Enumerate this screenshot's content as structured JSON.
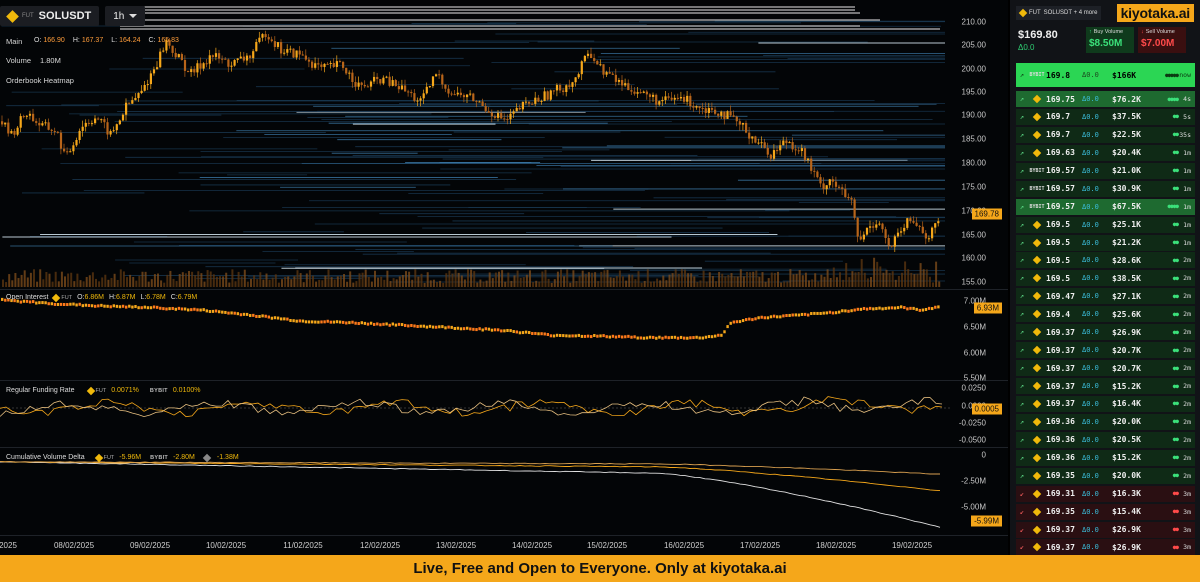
{
  "header": {
    "exchange_tag": "FUT",
    "symbol": "SOLUSDT",
    "timeframe": "1h"
  },
  "main_pane": {
    "title": "Main",
    "ohlc": [
      {
        "k": "O:",
        "v": "166.90"
      },
      {
        "k": "H:",
        "v": "167.37"
      },
      {
        "k": "L:",
        "v": "164.24"
      },
      {
        "k": "C:",
        "v": "165.83"
      }
    ],
    "volume_label": "Volume",
    "volume_value": "1.80M",
    "heatmap_label": "Orderbook Heatmap",
    "y_ticks": [
      "210.00",
      "205.00",
      "200.00",
      "195.00",
      "190.00",
      "185.00",
      "180.00",
      "175.00",
      "170.00",
      "165.00",
      "160.00",
      "155.00"
    ],
    "price_badge": "169.78"
  },
  "oi_pane": {
    "title": "Open Interest",
    "exchange_tag": "FUT",
    "ohlc": [
      {
        "k": "O:",
        "v": "6.86M"
      },
      {
        "k": "H:",
        "v": "6.87M"
      },
      {
        "k": "L:",
        "v": "6.78M"
      },
      {
        "k": "C:",
        "v": "6.79M"
      }
    ],
    "y_ticks": [
      "7.00M",
      "6.50M",
      "6.00M",
      "5.50M"
    ],
    "badge": "6.93M"
  },
  "funding_pane": {
    "title": "Regular Funding Rate",
    "ex1": "FUT",
    "v1": "0.0071%",
    "ex2": "BYBIT",
    "v2": "0.0100%",
    "y_ticks": [
      "0.0250",
      "0.0000",
      "-0.0250",
      "-0.0500"
    ],
    "badge": "0.0005"
  },
  "cvd_pane": {
    "title": "Cumulative Volume Delta",
    "ex1": "FUT",
    "v1": "-5.96M",
    "ex2": "BYBIT",
    "v2": "-2.80M",
    "ex3": "",
    "v3": "-1.38M",
    "y_ticks": [
      "0",
      "-2.50M",
      "-5.00M"
    ],
    "badge": "-5.99M"
  },
  "x_axis": [
    "2025",
    "08/02/2025",
    "09/02/2025",
    "10/02/2025",
    "11/02/2025",
    "12/02/2025",
    "13/02/2025",
    "14/02/2025",
    "15/02/2025",
    "16/02/2025",
    "17/02/2025",
    "18/02/2025",
    "19/02/2025"
  ],
  "chart_data": {
    "type": "candlestick",
    "symbol": "SOLUSDT",
    "timeframe": "1h",
    "price_axis": {
      "ylim": [
        155,
        212
      ]
    },
    "price_path": [
      [
        0,
        189
      ],
      [
        10,
        186
      ],
      [
        25,
        191
      ],
      [
        40,
        188
      ],
      [
        55,
        187
      ],
      [
        65,
        181
      ],
      [
        80,
        188
      ],
      [
        95,
        190
      ],
      [
        110,
        186
      ],
      [
        125,
        192
      ],
      [
        140,
        195
      ],
      [
        155,
        201
      ],
      [
        165,
        206
      ],
      [
        175,
        203
      ],
      [
        190,
        199
      ],
      [
        210,
        203
      ],
      [
        230,
        201
      ],
      [
        250,
        203
      ],
      [
        265,
        208
      ],
      [
        280,
        204
      ],
      [
        300,
        203
      ],
      [
        320,
        200
      ],
      [
        340,
        201
      ],
      [
        360,
        196
      ],
      [
        380,
        198
      ],
      [
        400,
        196
      ],
      [
        420,
        193
      ],
      [
        435,
        199
      ],
      [
        450,
        195
      ],
      [
        470,
        194
      ],
      [
        490,
        191
      ],
      [
        505,
        189
      ],
      [
        520,
        192
      ],
      [
        540,
        194
      ],
      [
        560,
        196
      ],
      [
        575,
        198
      ],
      [
        588,
        204
      ],
      [
        600,
        200
      ],
      [
        620,
        197
      ],
      [
        640,
        195
      ],
      [
        660,
        193
      ],
      [
        680,
        194
      ],
      [
        700,
        192
      ],
      [
        720,
        191
      ],
      [
        740,
        188
      ],
      [
        755,
        185
      ],
      [
        770,
        182
      ],
      [
        785,
        185
      ],
      [
        800,
        183
      ],
      [
        810,
        179
      ],
      [
        820,
        175
      ],
      [
        830,
        177
      ],
      [
        840,
        174
      ],
      [
        850,
        172
      ],
      [
        858,
        163
      ],
      [
        868,
        167
      ],
      [
        878,
        168
      ],
      [
        888,
        162
      ],
      [
        898,
        165
      ],
      [
        908,
        168
      ],
      [
        918,
        167
      ],
      [
        928,
        164
      ],
      [
        940,
        169.8
      ]
    ],
    "open_interest": [
      [
        0,
        7.05
      ],
      [
        50,
        6.98
      ],
      [
        100,
        6.93
      ],
      [
        150,
        6.9
      ],
      [
        200,
        6.85
      ],
      [
        250,
        6.75
      ],
      [
        300,
        6.63
      ],
      [
        350,
        6.6
      ],
      [
        400,
        6.55
      ],
      [
        450,
        6.5
      ],
      [
        500,
        6.45
      ],
      [
        550,
        6.35
      ],
      [
        600,
        6.33
      ],
      [
        650,
        6.3
      ],
      [
        700,
        6.3
      ],
      [
        720,
        6.35
      ],
      [
        730,
        6.6
      ],
      [
        760,
        6.7
      ],
      [
        800,
        6.75
      ],
      [
        830,
        6.8
      ],
      [
        860,
        6.87
      ],
      [
        900,
        6.9
      ],
      [
        920,
        6.85
      ],
      [
        940,
        6.93
      ]
    ],
    "funding_series": [
      {
        "name": "FUT",
        "color": "#f5a71a"
      },
      {
        "name": "BYBIT",
        "color": "#e8c080"
      }
    ],
    "cvd_series": [
      {
        "name": "FUT",
        "value": -5.96,
        "color": "#e0e0e0"
      },
      {
        "name": "BYBIT",
        "value": -2.8,
        "color": "#f5a71a"
      },
      {
        "value": -1.38,
        "color": "#d9a050"
      }
    ]
  },
  "sidebar": {
    "exchange_tag": "FUT",
    "symbols_chip": "SOLUSDT + 4 more",
    "brand": "kiyotaka.ai",
    "price": "$169.80",
    "delta": "Δ0.0",
    "buy_volume_label": "Buy Volume",
    "buy_volume": "$8.50M",
    "sell_volume_label": "Sell Volume",
    "sell_volume": "$7.00M",
    "trades": [
      {
        "side": "buy",
        "style": "top",
        "ex": "BYBIT",
        "price": "169.8",
        "delta": "Δ0.0",
        "size": "$166K",
        "dots": "●●●●●",
        "ago": "now"
      },
      {
        "side": "buy",
        "style": "hi",
        "ex": "FUT",
        "price": "169.75",
        "delta": "Δ0.0",
        "size": "$76.2K",
        "dots": "●●●●",
        "ago": "4s"
      },
      {
        "side": "buy",
        "style": "",
        "ex": "FUT",
        "price": "169.7",
        "delta": "Δ0.0",
        "size": "$37.5K",
        "dots": "●●",
        "ago": "5s"
      },
      {
        "side": "buy",
        "style": "",
        "ex": "FUT",
        "price": "169.7",
        "delta": "Δ0.0",
        "size": "$22.5K",
        "dots": "●●",
        "ago": "35s"
      },
      {
        "side": "buy",
        "style": "",
        "ex": "FUT",
        "price": "169.63",
        "delta": "Δ0.0",
        "size": "$20.4K",
        "dots": "●●",
        "ago": "1m"
      },
      {
        "side": "buy",
        "style": "",
        "ex": "BYBIT",
        "price": "169.57",
        "delta": "Δ0.0",
        "size": "$21.0K",
        "dots": "●●",
        "ago": "1m"
      },
      {
        "side": "buy",
        "style": "",
        "ex": "BYBIT",
        "price": "169.57",
        "delta": "Δ0.0",
        "size": "$30.9K",
        "dots": "●●",
        "ago": "1m"
      },
      {
        "side": "buy",
        "style": "hi",
        "ex": "BYBIT",
        "price": "169.57",
        "delta": "Δ0.0",
        "size": "$67.5K",
        "dots": "●●●●",
        "ago": "1m"
      },
      {
        "side": "buy",
        "style": "",
        "ex": "FUT",
        "price": "169.5",
        "delta": "Δ0.0",
        "size": "$25.1K",
        "dots": "●●",
        "ago": "1m"
      },
      {
        "side": "buy",
        "style": "",
        "ex": "FUT",
        "price": "169.5",
        "delta": "Δ0.0",
        "size": "$21.2K",
        "dots": "●●",
        "ago": "1m"
      },
      {
        "side": "buy",
        "style": "",
        "ex": "FUT",
        "price": "169.5",
        "delta": "Δ0.0",
        "size": "$28.6K",
        "dots": "●●",
        "ago": "2m"
      },
      {
        "side": "buy",
        "style": "",
        "ex": "FUT",
        "price": "169.5",
        "delta": "Δ0.0",
        "size": "$38.5K",
        "dots": "●●",
        "ago": "2m"
      },
      {
        "side": "buy",
        "style": "",
        "ex": "FUT",
        "price": "169.47",
        "delta": "Δ0.0",
        "size": "$27.1K",
        "dots": "●●",
        "ago": "2m"
      },
      {
        "side": "buy",
        "style": "",
        "ex": "FUT",
        "price": "169.4",
        "delta": "Δ0.0",
        "size": "$25.6K",
        "dots": "●●",
        "ago": "2m"
      },
      {
        "side": "buy",
        "style": "",
        "ex": "FUT",
        "price": "169.37",
        "delta": "Δ0.0",
        "size": "$26.9K",
        "dots": "●●",
        "ago": "2m"
      },
      {
        "side": "buy",
        "style": "",
        "ex": "FUT",
        "price": "169.37",
        "delta": "Δ0.0",
        "size": "$20.7K",
        "dots": "●●",
        "ago": "2m"
      },
      {
        "side": "buy",
        "style": "",
        "ex": "FUT",
        "price": "169.37",
        "delta": "Δ0.0",
        "size": "$20.7K",
        "dots": "●●",
        "ago": "2m"
      },
      {
        "side": "buy",
        "style": "",
        "ex": "FUT",
        "price": "169.37",
        "delta": "Δ0.0",
        "size": "$15.2K",
        "dots": "●●",
        "ago": "2m"
      },
      {
        "side": "buy",
        "style": "",
        "ex": "FUT",
        "price": "169.37",
        "delta": "Δ0.0",
        "size": "$16.4K",
        "dots": "●●",
        "ago": "2m"
      },
      {
        "side": "buy",
        "style": "",
        "ex": "FUT",
        "price": "169.36",
        "delta": "Δ0.0",
        "size": "$20.0K",
        "dots": "●●",
        "ago": "2m"
      },
      {
        "side": "buy",
        "style": "",
        "ex": "FUT",
        "price": "169.36",
        "delta": "Δ0.0",
        "size": "$20.5K",
        "dots": "●●",
        "ago": "2m"
      },
      {
        "side": "buy",
        "style": "",
        "ex": "FUT",
        "price": "169.36",
        "delta": "Δ0.0",
        "size": "$15.2K",
        "dots": "●●",
        "ago": "2m"
      },
      {
        "side": "buy",
        "style": "",
        "ex": "FUT",
        "price": "169.35",
        "delta": "Δ0.0",
        "size": "$20.0K",
        "dots": "●●",
        "ago": "2m"
      },
      {
        "side": "sell",
        "style": "",
        "ex": "FUT",
        "price": "169.31",
        "delta": "Δ0.0",
        "size": "$16.3K",
        "dots": "●●",
        "ago": "3m"
      },
      {
        "side": "sell",
        "style": "",
        "ex": "FUT",
        "price": "169.35",
        "delta": "Δ0.0",
        "size": "$15.4K",
        "dots": "●●",
        "ago": "3m"
      },
      {
        "side": "sell",
        "style": "",
        "ex": "FUT",
        "price": "169.37",
        "delta": "Δ0.0",
        "size": "$26.9K",
        "dots": "●●",
        "ago": "3m"
      },
      {
        "side": "sell",
        "style": "",
        "ex": "FUT",
        "price": "169.37",
        "delta": "Δ0.0",
        "size": "$26.9K",
        "dots": "●●",
        "ago": "3m"
      }
    ]
  },
  "footer": {
    "text": "Live, Free and Open to Everyone. Only at",
    "brand": "kiyotaka.ai"
  },
  "colors": {
    "accent": "#f5a71a",
    "buy": "#2bd654",
    "sell": "#ff4a4a",
    "background": "#030507"
  }
}
